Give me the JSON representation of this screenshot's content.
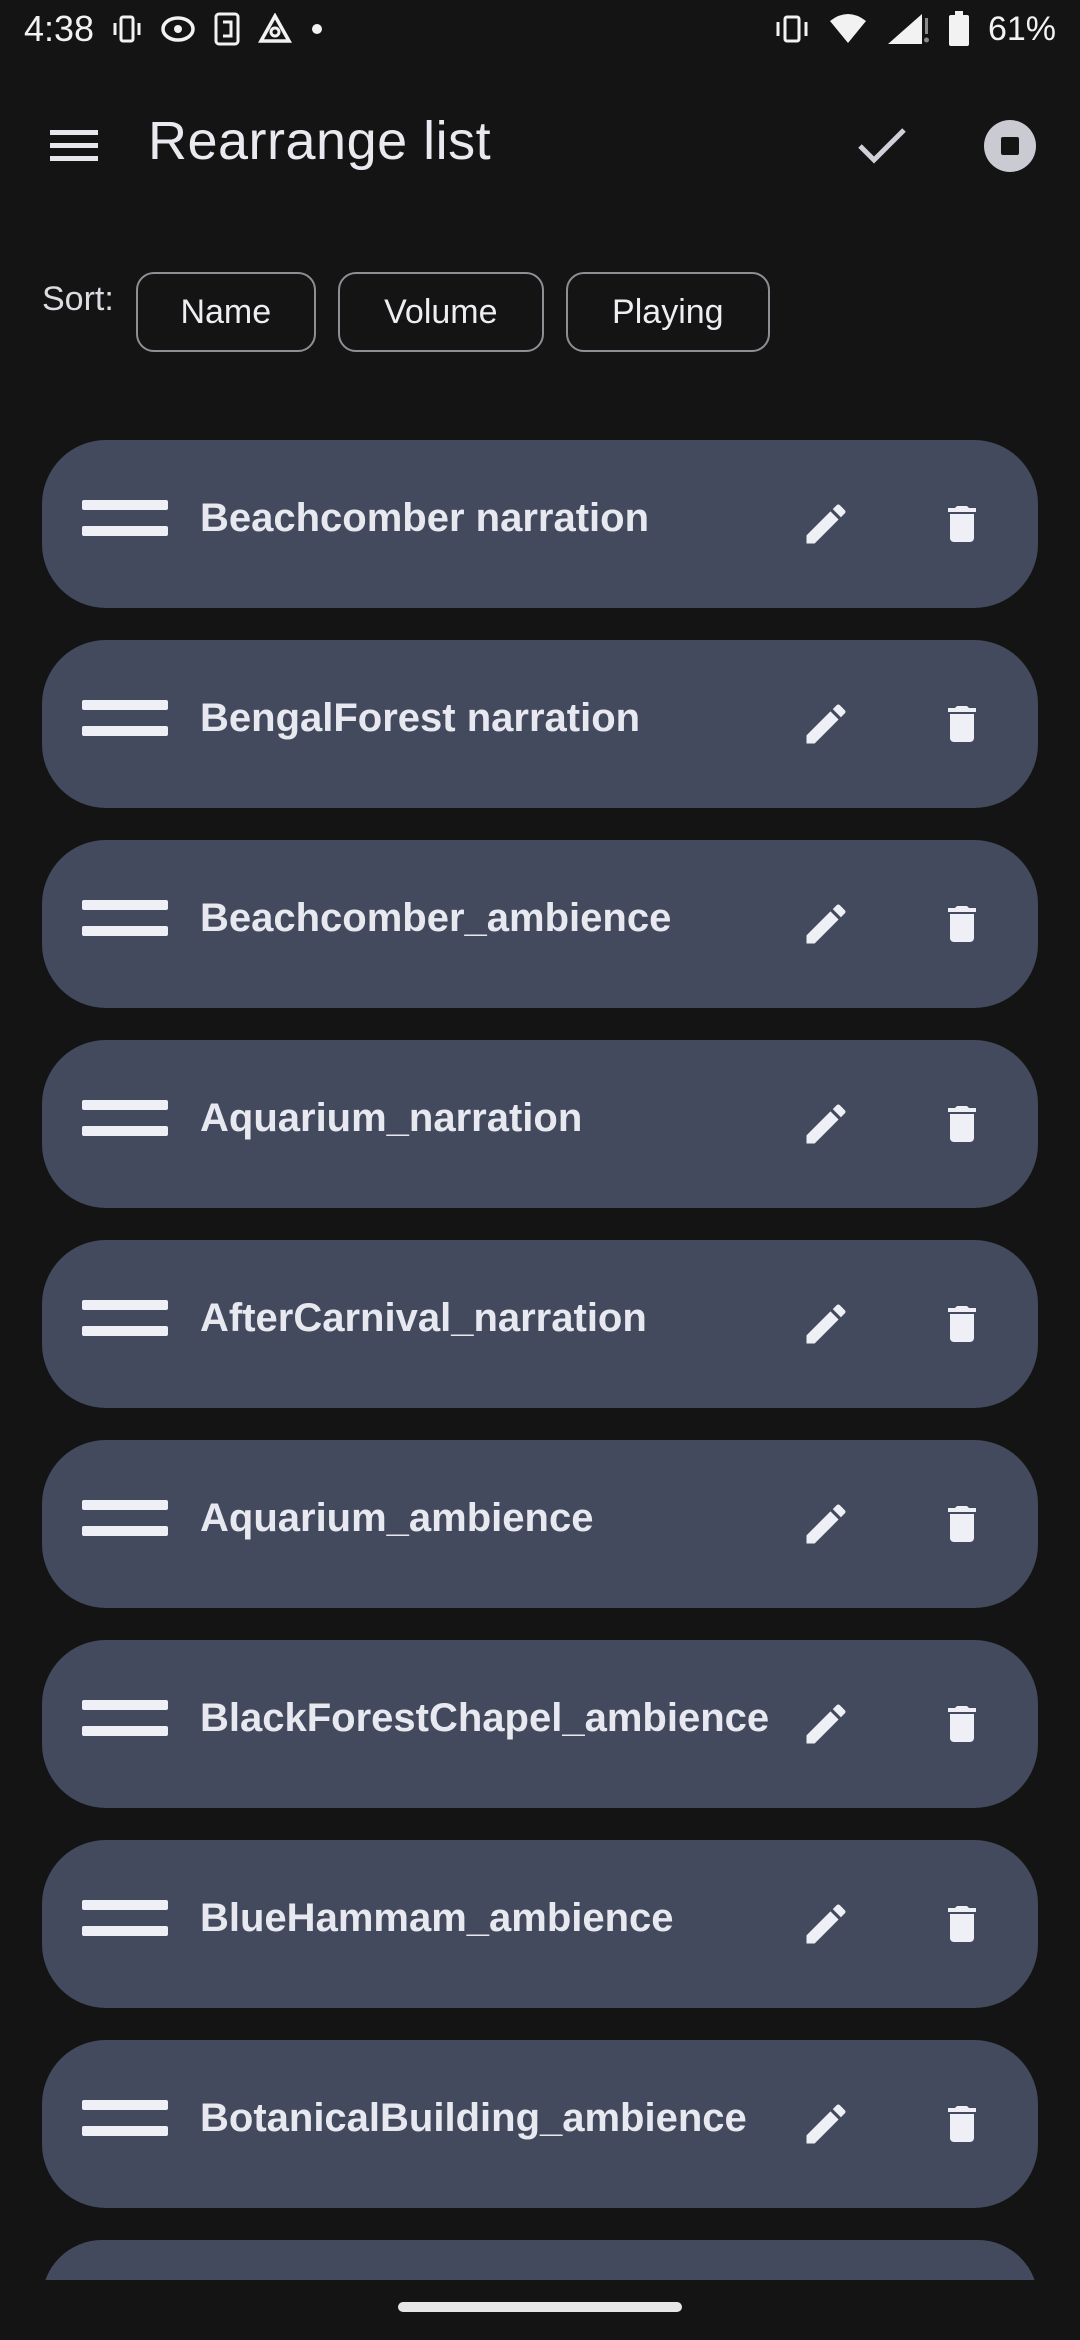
{
  "status_bar": {
    "time": "4:38",
    "battery_percent": "61%",
    "left_icons": [
      "vibrate-icon",
      "sync-icon",
      "nfc-icon",
      "triangle-app-icon",
      "dot-icon"
    ],
    "right_icons": [
      "vibrate-icon",
      "wifi-icon",
      "signal-icon",
      "battery-icon"
    ]
  },
  "app_bar": {
    "title": "Rearrange list",
    "menu_icon": "menu-icon",
    "confirm_icon": "check-icon",
    "stop_icon": "stop-circle-icon"
  },
  "sort": {
    "label": "Sort:",
    "options": [
      "Name",
      "Volume",
      "Playing"
    ]
  },
  "items": [
    {
      "label": "Beachcomber narration"
    },
    {
      "label": "BengalForest narration"
    },
    {
      "label": "Beachcomber_ambience"
    },
    {
      "label": "Aquarium_narration"
    },
    {
      "label": "AfterCarnival_narration"
    },
    {
      "label": "Aquarium_ambience"
    },
    {
      "label": "BlackForestChapel_ambience"
    },
    {
      "label": "BlueHammam_ambience"
    },
    {
      "label": "BotanicalBuilding_ambience"
    }
  ],
  "colors": {
    "background": "#141414",
    "item_background": "#434a5e",
    "text": "#e8e9f0",
    "chip_border": "#8e8e95"
  }
}
